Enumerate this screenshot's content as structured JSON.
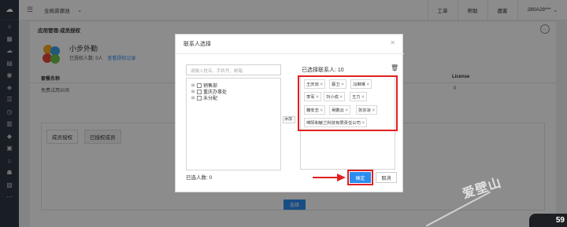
{
  "topbar": {
    "scope": "全局资源池",
    "ticket": "工单",
    "help": "帮助",
    "notice": "邀客",
    "user": "280A28***"
  },
  "content": {
    "breadcrumb": "应用管理-成员授权",
    "app_name": "小步外勤",
    "authorized_count": "已授权人数: 0人",
    "auth_record_link": "查看授权记录",
    "license_header_name": "套餐名称",
    "license_header_license": "License",
    "license_row_name": "免费试用30天",
    "license_row_value": "0",
    "tabs": [
      "成员授权",
      "已授权成员"
    ],
    "select_button": "选择"
  },
  "modal": {
    "title": "联系人选择",
    "search_placeholder": "请输入姓名、手机号、邮箱",
    "tree": [
      {
        "label": "销售部"
      },
      {
        "label": "重庆办事处"
      },
      {
        "label": "未分配"
      }
    ],
    "add_button": "添加",
    "selected_people_label": "已选人数: 0",
    "selected_contacts_label": "已选择联系人: 10",
    "chips": [
      "王庆双",
      "蔡卫",
      "冯琳琳",
      "李军",
      "刘小成",
      "王力",
      "魏安志",
      "吴鹏云",
      "张宗凉",
      "绵阳和敏兰科技有限责任公司"
    ],
    "ok": "确定",
    "cancel": "取消"
  },
  "watermark": "爱壁山",
  "speed_badge": "59",
  "colors": {
    "primary": "#2d8cf0",
    "highlight": "#e02020",
    "rail": "#2f3642"
  }
}
